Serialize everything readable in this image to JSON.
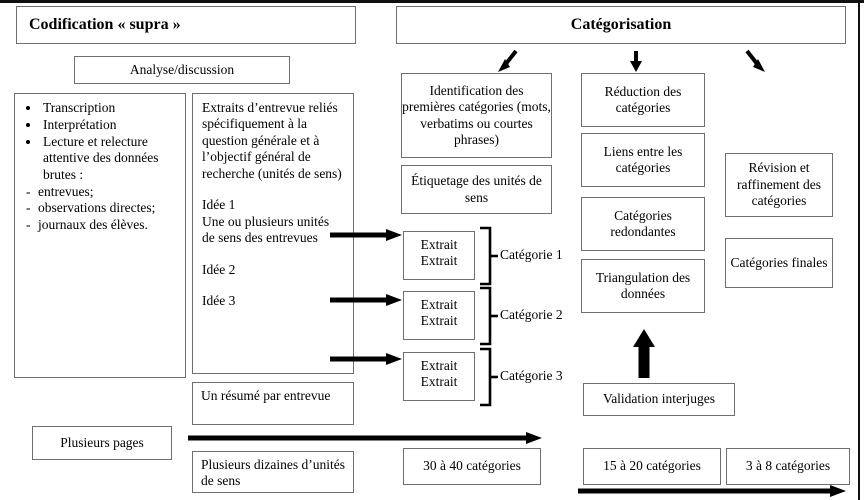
{
  "diagram": {
    "headers": {
      "left": "Codification « supra »",
      "right": "Catégorisation"
    },
    "left_column": {
      "analyse_box": "Analyse/discussion",
      "steps_box": {
        "bullets": [
          "Transcription",
          "Interprétation",
          "Lecture et relecture attentive des données brutes :"
        ],
        "sub_items": [
          "entrevues;",
          "observations directes;",
          "journaux des élèves."
        ]
      },
      "extracts_box": {
        "intro": "Extraits d’entrevue reliés spécifiquement à la question générale et à l’objectif général de recherche (unités de sens)",
        "idea1_title": "Idée 1",
        "idea1_text": "Une ou plusieurs unités de sens des entrevues",
        "idea2": "Idée 2",
        "idea3": "Idée 3"
      },
      "summary_box": "Un résumé par entrevue",
      "pages_box": "Plusieurs pages",
      "units_box": "Plusieurs dizaines d’unités de sens"
    },
    "middle_column": {
      "identification_box": "Identification des premières catégories (mots, verbatims ou courtes phrases)",
      "labelling_box": "Étiquetage des unités de sens",
      "extract_groups": [
        {
          "lines": [
            "Extrait",
            "Extrait"
          ],
          "label": "Catégorie 1"
        },
        {
          "lines": [
            "Extrait",
            "Extrait"
          ],
          "label": "Catégorie 2"
        },
        {
          "lines": [
            "Extrait",
            "Extrait"
          ],
          "label": "Catégorie 3"
        }
      ],
      "count_box": "30 à 40 catégories"
    },
    "right_column": {
      "reduction_box": "Réduction des catégories",
      "links_box": "Liens entre les catégories",
      "redundant_box": "Catégories redondantes",
      "triangulation_box": "Triangulation des données",
      "validation_box": "Validation interjuges",
      "count_box": "15 à 20 catégories"
    },
    "far_right_column": {
      "revision_box": "Révision et raffinement des catégories",
      "final_box": "Catégories finales",
      "count_box": "3 à 8 catégories"
    }
  }
}
